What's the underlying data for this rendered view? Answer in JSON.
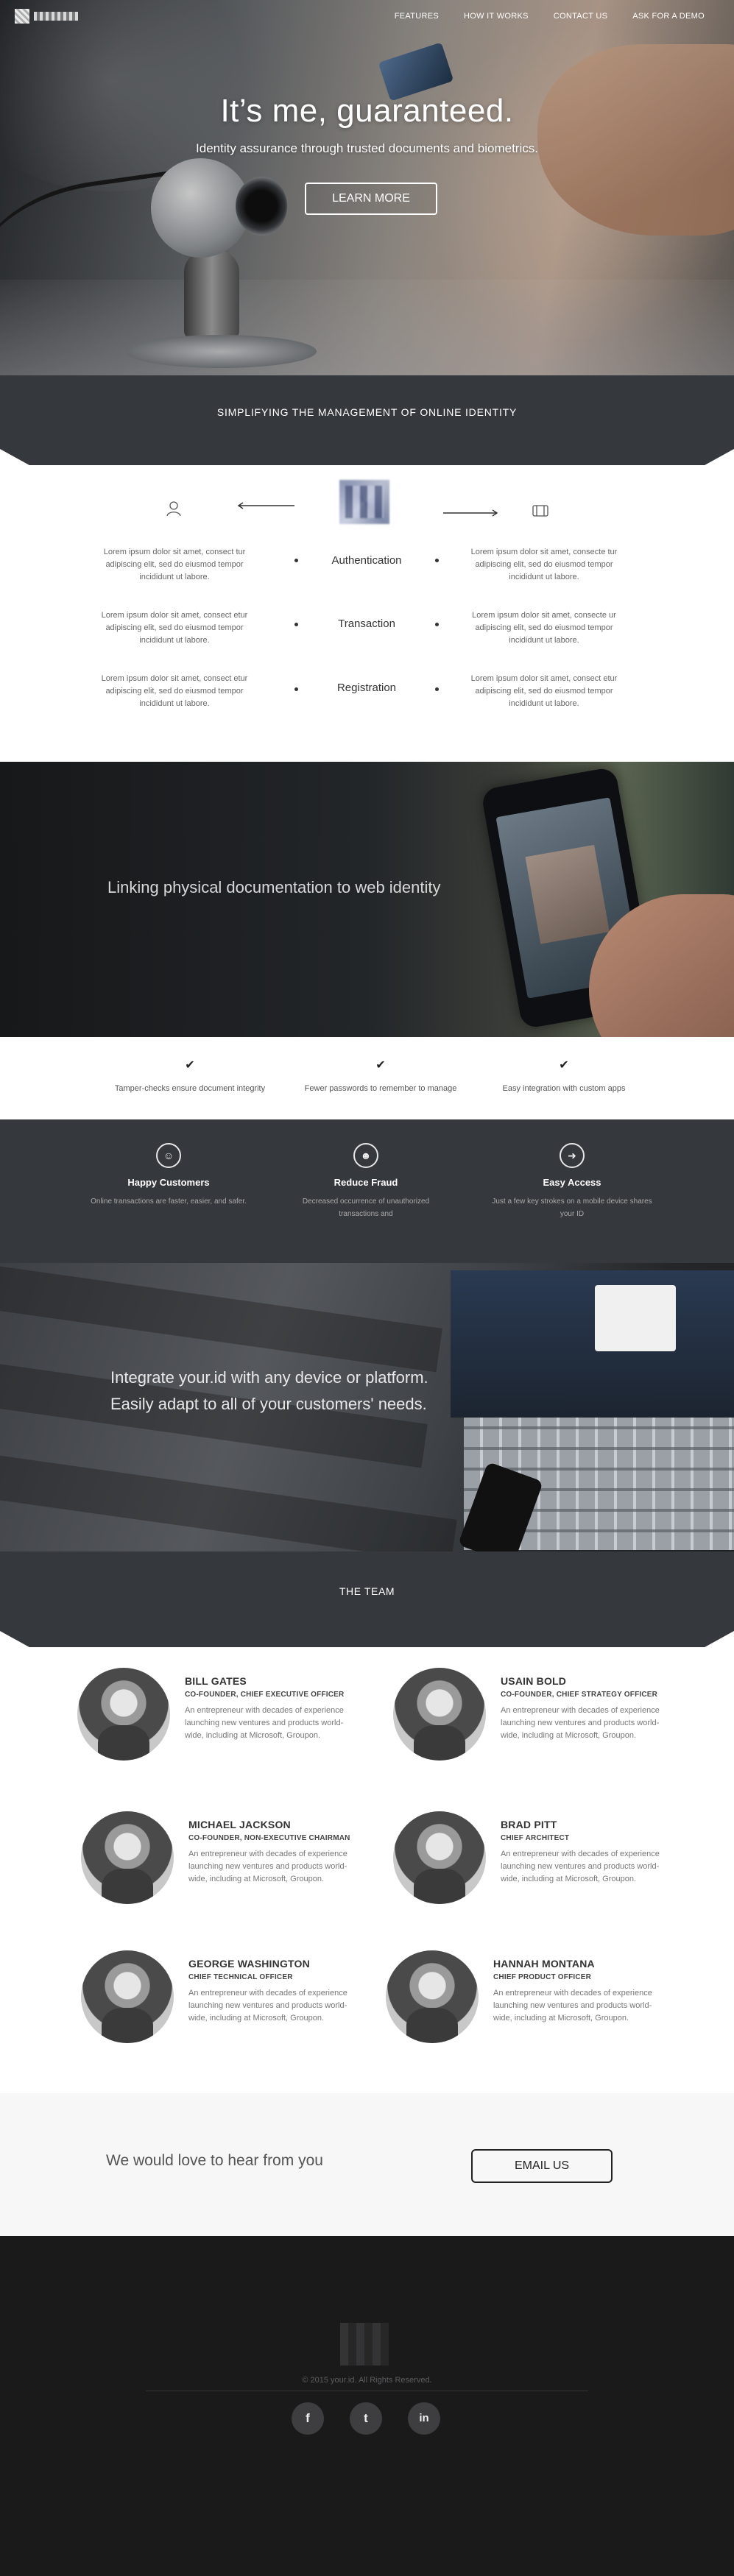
{
  "nav": {
    "items": [
      "FEATURES",
      "HOW IT WORKS",
      "CONTACT US",
      "ASK FOR A DEMO"
    ]
  },
  "hero": {
    "title": "It’s me, guaranteed.",
    "subtitle": "Identity assurance through trusted documents and biometrics.",
    "cta": "LEARN MORE"
  },
  "simplify": {
    "heading": "SIMPLIFYING THE MANAGEMENT OF ONLINE IDENTITY"
  },
  "features": {
    "rows": [
      {
        "left": "Lorem ipsum dolor sit amet, consect tur adipiscing elit, sed do eiusmod tempor incididunt ut labore.",
        "label": "Authentication",
        "right": "Lorem ipsum dolor sit amet, consecte tur adipiscing elit, sed do eiusmod tempor incididunt ut labore."
      },
      {
        "left": "Lorem ipsum dolor sit amet, consect etur adipiscing elit, sed do eiusmod tempor incididunt ut labore.",
        "label": "Transaction",
        "right": "Lorem ipsum dolor sit amet, consecte ur adipiscing elit, sed do eiusmod tempor incididunt ut labore."
      },
      {
        "left": "Lorem ipsum dolor sit amet, consect etur adipiscing elit, sed do eiusmod tempor incididunt ut labore.",
        "label": "Registration",
        "right": "Lorem ipsum dolor sit amet, consect etur adipiscing elit, sed do eiusmod tempor incididunt ut labore."
      }
    ]
  },
  "linking": {
    "heading": "Linking physical documentation to web identity"
  },
  "checks": [
    "Tamper-checks ensure document integrity",
    "Fewer passwords to remember to manage",
    "Easy integration with custom apps"
  ],
  "benefits": [
    {
      "title": "Happy Customers",
      "text": "Online transactions are faster, easier, and safer."
    },
    {
      "title": "Reduce Fraud",
      "text": "Decreased occurrence of unauthorized transactions and"
    },
    {
      "title": "Easy Access",
      "text": "Just a few key strokes on a mobile device shares your ID"
    }
  ],
  "integrate": {
    "line1": "Integrate your.id with any device or platform.",
    "line2": "Easily adapt to all of your customers' needs."
  },
  "team_band": {
    "heading": "THE TEAM"
  },
  "team": [
    {
      "name": "BILL GATES",
      "role": "CO-FOUNDER, CHIEF EXECUTIVE OFFICER",
      "bio": "An entrepreneur with decades of experience launching new ventures and products world-wide, including at Microsoft, Groupon."
    },
    {
      "name": "USAIN BOLD",
      "role": "CO-FOUNDER, CHIEF STRATEGY OFFICER",
      "bio": "An entrepreneur with decades of experience launching new ventures and products world-wide, including at Microsoft, Groupon."
    },
    {
      "name": "MICHAEL JACKSON",
      "role": "CO-FOUNDER, NON-EXECUTIVE CHAIRMAN",
      "bio": "An entrepreneur with decades of experience launching new ventures and products world-wide, including at Microsoft, Groupon."
    },
    {
      "name": "BRAD PITT",
      "role": "CHIEF ARCHITECT",
      "bio": "An entrepreneur with decades of experience launching new ventures and products world-wide, including at Microsoft, Groupon."
    },
    {
      "name": "GEORGE WASHINGTON",
      "role": "CHIEF TECHNICAL OFFICER",
      "bio": "An entrepreneur with decades of experience launching new ventures and products world-wide, including at Microsoft, Groupon."
    },
    {
      "name": "HANNAH MONTANA",
      "role": "CHIEF PRODUCT OFFICER",
      "bio": "An entrepreneur with decades of experience launching new ventures and products world-wide, including at Microsoft, Groupon."
    }
  ],
  "contact": {
    "text": "We would love to hear from you",
    "button": "EMAIL US"
  },
  "footer": {
    "copyright": "© 2015 your.id. All Rights Reserved.",
    "social": [
      "facebook-icon",
      "twitter-icon",
      "linkedin-icon"
    ],
    "social_glyphs": [
      "f",
      "t",
      "in"
    ]
  }
}
